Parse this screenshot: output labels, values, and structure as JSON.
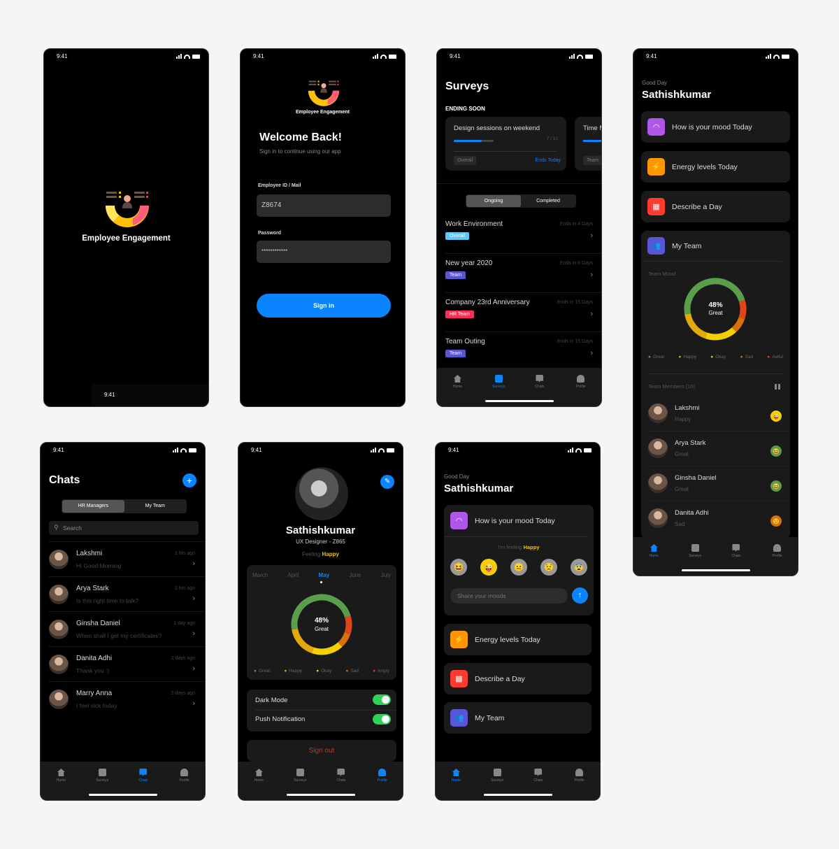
{
  "status_time": "9:41",
  "colors": {
    "accent": "#0a84ff",
    "great": "#5a9e4b",
    "happy": "#e3a80b",
    "okay": "#f5d000",
    "sad": "#d9700b",
    "awful": "#e0461b",
    "purple": "#b056e8",
    "orange": "#ff9500",
    "red": "#ff3b30",
    "indigo": "#5856d6",
    "cyan": "#5ac8fa",
    "pink": "#ff2d55"
  },
  "splash": {
    "app_name": "Employee Engagement",
    "bottom_time": "9:41"
  },
  "login": {
    "app_name": "Employee Engagement",
    "title": "Welcome Back!",
    "subtitle": "Sign in to continue using our app",
    "id_label": "Employee ID / Mail",
    "id_value": "Z8674",
    "password_label": "Password",
    "password_value": "************",
    "signin_label": "Sign in"
  },
  "tabs": [
    "Home",
    "Surveys",
    "Chats",
    "Profile"
  ],
  "surveys": {
    "title": "Surveys",
    "section": "ENDING SOON",
    "featured": [
      {
        "title": "Design sessions on weekend",
        "progress": "7 / 10",
        "progress_value": 0.7,
        "tag": "Overall",
        "ends": "Ends Today"
      },
      {
        "title": "Time M",
        "tag": "Team"
      }
    ],
    "segments": [
      "Ongoing",
      "Completed"
    ],
    "list": [
      {
        "title": "Work Environment",
        "ends": "Ends in 4 Days",
        "tag": "Overall",
        "tag_color": "#5ac8fa"
      },
      {
        "title": "New year 2020",
        "ends": "Ends in 6 Days",
        "tag": "Team",
        "tag_color": "#5856d6"
      },
      {
        "title": "Company 23rd Anniversary",
        "ends": "Ends in 15 Days",
        "tag": "HR Team",
        "tag_color": "#ff2d55"
      },
      {
        "title": "Team Outing",
        "ends": "Ends in 15 Days",
        "tag": "Team",
        "tag_color": "#5856d6"
      }
    ]
  },
  "home": {
    "greeting": "Good Day",
    "name": "Sathishkumar",
    "cards": [
      "How is your mood Today",
      "Energy levels Today",
      "Describe a Day",
      "My Team"
    ],
    "team_mood_label": "Team Mood",
    "mood_percent": "48%",
    "mood_label": "Great",
    "legend": [
      "Great",
      "Happy",
      "Okay",
      "Sad",
      "Awful"
    ],
    "members_label": "Team Members (10)",
    "members": [
      {
        "name": "Lakshmi",
        "mood": "Happy"
      },
      {
        "name": "Arya Stark",
        "mood": "Great"
      },
      {
        "name": "Ginsha Daniel",
        "mood": "Great"
      },
      {
        "name": "Danita Adhi",
        "mood": "Sad"
      }
    ]
  },
  "chats": {
    "title": "Chats",
    "segments": [
      "HR Managers",
      "My Team"
    ],
    "search_placeholder": "Search",
    "list": [
      {
        "name": "Lakshmi",
        "message": "Hi Good Morning",
        "time": "1 hrs ago"
      },
      {
        "name": "Arya Stark",
        "message": "Is this right time to talk?",
        "time": "2 hrs ago"
      },
      {
        "name": "Ginsha Daniel",
        "message": "When shall I get my certificates?",
        "time": "1 day ago"
      },
      {
        "name": "Danita Adhi",
        "message": "Thank you :)",
        "time": "2 days ago"
      },
      {
        "name": "Marry Anna",
        "message": "I feel sick today",
        "time": "2 days ago"
      }
    ]
  },
  "profile": {
    "name": "Sathishkumar",
    "role": "UX Designer - Z865",
    "feeling_prefix": "Feeling",
    "feeling": "Happy",
    "months": [
      "March",
      "April",
      "May",
      "June",
      "July"
    ],
    "selected_month": "May",
    "mood_percent": "48%",
    "mood_label": "Great",
    "legend": [
      "Great",
      "Happy",
      "Okay",
      "Sad",
      "Angry"
    ],
    "dark_mode_label": "Dark Mode",
    "dark_mode_on": true,
    "push_label": "Push Notification",
    "push_on": true,
    "signout_label": "Sign out"
  },
  "mood_home": {
    "greeting": "Good Day",
    "name": "Sathishkumar",
    "mood_card": "How is your mood Today",
    "feeling_prefix": "I'm feeling",
    "feeling": "Happy",
    "share_placeholder": "Share your moods",
    "cards": [
      "Energy levels Today",
      "Describe a Day",
      "My Team"
    ]
  },
  "chart_data": {
    "type": "pie",
    "title": "Team Mood",
    "center_label": "48% Great",
    "categories": [
      "Great",
      "Happy",
      "Okay",
      "Sad",
      "Awful"
    ],
    "values": [
      48,
      17,
      17,
      8,
      10
    ]
  }
}
